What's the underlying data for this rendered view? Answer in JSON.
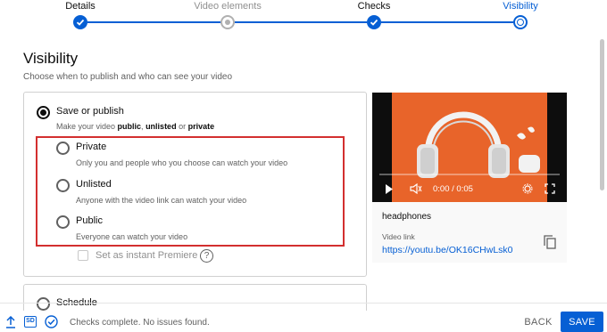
{
  "stepper": {
    "steps": [
      {
        "label": "Details",
        "state": "done"
      },
      {
        "label": "Video elements",
        "state": "pending"
      },
      {
        "label": "Checks",
        "state": "done"
      },
      {
        "label": "Visibility",
        "state": "current"
      }
    ]
  },
  "page": {
    "title": "Visibility",
    "subtitle": "Choose when to publish and who can see your video"
  },
  "save_publish": {
    "title": "Save or publish",
    "desc_prefix": "Make your video ",
    "desc_public": "public",
    "desc_sep1": ", ",
    "desc_unlisted": "unlisted",
    "desc_sep2": " or ",
    "desc_private": "private",
    "options": [
      {
        "title": "Private",
        "desc": "Only you and people who you choose can watch your video"
      },
      {
        "title": "Unlisted",
        "desc": "Anyone with the video link can watch your video"
      },
      {
        "title": "Public",
        "desc": "Everyone can watch your video"
      }
    ],
    "premiere_label": "Set as instant Premiere",
    "help_symbol": "?"
  },
  "schedule": {
    "title": "Schedule"
  },
  "video": {
    "time": "0:00 / 0:05",
    "name": "headphones",
    "link_label": "Video link",
    "link": "https://youtu.be/OK16CHwLsk0"
  },
  "footer": {
    "status": "Checks complete. No issues found.",
    "sd_badge": "SD",
    "back_label": "BACK",
    "save_label": "SAVE"
  },
  "colors": {
    "accent": "#065fd4",
    "highlight": "#d32f2f",
    "video_bg": "#e8642a"
  }
}
